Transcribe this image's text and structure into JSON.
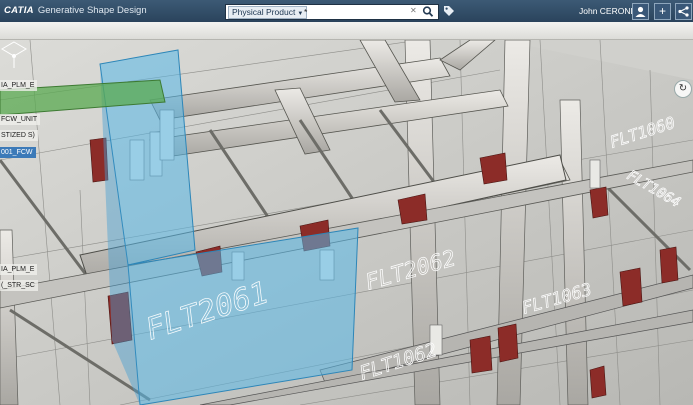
{
  "app": {
    "brand": "CATIA",
    "title": "Generative Shape Design"
  },
  "search": {
    "scope": "Physical Product",
    "value": "*"
  },
  "user": {
    "name": "John CERONE"
  },
  "icons": {
    "search": "magnifier-icon",
    "tag": "tag-icon",
    "profile": "user-icon",
    "add": "plus-icon",
    "share": "share-icon",
    "compass": "compass-icon"
  },
  "tree": {
    "items": [
      {
        "label": "IA_PLM_E",
        "selected": false
      },
      {
        "label": "FCW_UNIT",
        "selected": false
      },
      {
        "label": "STIZED S)",
        "selected": false
      },
      {
        "label": "001_FCW",
        "selected": true
      },
      {
        "label": "IA_PLM_E",
        "selected": false
      },
      {
        "label": "(_STR_SC",
        "selected": false
      }
    ]
  },
  "model_labels": {
    "flt2061": "FLT2061",
    "flt2062": "FLT2062",
    "flt1062": "FLT1062",
    "flt1063": "FLT1063",
    "flt1060": "FLT1060",
    "flt1064": "FLT1064"
  },
  "colors": {
    "header": "#2f4a66",
    "highlight": "#58b8e8",
    "selection": "#3c7ab8",
    "clips": "#8c2c28"
  }
}
